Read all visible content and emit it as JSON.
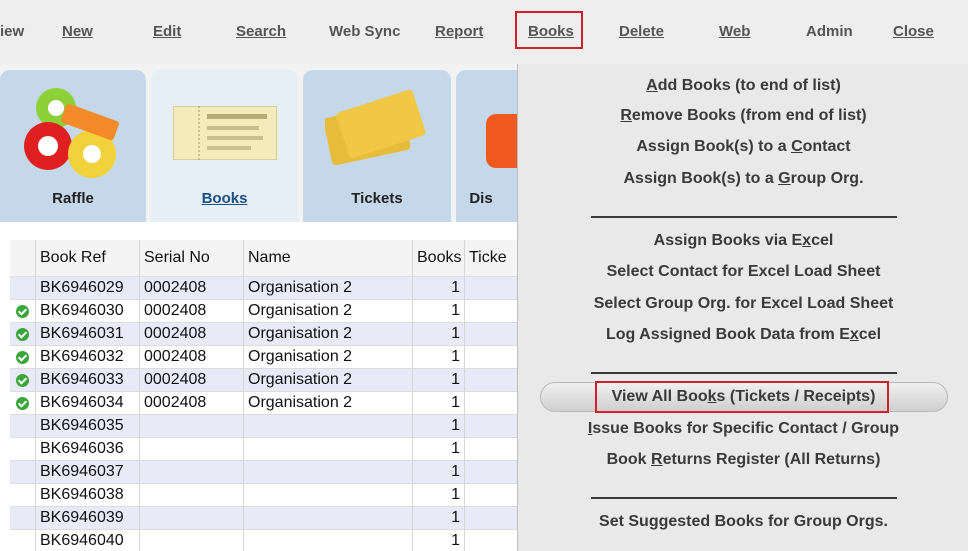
{
  "menubar": {
    "items": [
      {
        "label": "iew",
        "underline": false
      },
      {
        "label": "New",
        "underline": true
      },
      {
        "label": "Edit",
        "underline": true
      },
      {
        "label": "Search",
        "underline": true
      },
      {
        "label": "Web Sync",
        "underline": false
      },
      {
        "label": "Report",
        "underline": true
      },
      {
        "label": "Books",
        "underline": true
      },
      {
        "label": "Delete",
        "underline": true
      },
      {
        "label": "Web",
        "underline": true
      },
      {
        "label": "Admin",
        "underline": false
      },
      {
        "label": "Close",
        "underline": true
      }
    ]
  },
  "tabs": [
    {
      "label": "Raffle",
      "icon": "raffle-balls-icon"
    },
    {
      "label": "Books",
      "icon": "raffle-book-icon"
    },
    {
      "label": "Tickets",
      "icon": "ticket-icon"
    },
    {
      "label": "Dis",
      "icon": "discount-tag-icon"
    }
  ],
  "grid": {
    "columns": [
      "",
      "Book Ref",
      "Serial No",
      "Name",
      "Books",
      "Ticke"
    ],
    "rows": [
      {
        "check": false,
        "ref": "BK6946029",
        "serial": "0002408",
        "name": "Organisation 2",
        "books": "1"
      },
      {
        "check": true,
        "ref": "BK6946030",
        "serial": "0002408",
        "name": "Organisation 2",
        "books": "1"
      },
      {
        "check": true,
        "ref": "BK6946031",
        "serial": "0002408",
        "name": "Organisation 2",
        "books": "1"
      },
      {
        "check": true,
        "ref": "BK6946032",
        "serial": "0002408",
        "name": "Organisation 2",
        "books": "1"
      },
      {
        "check": true,
        "ref": "BK6946033",
        "serial": "0002408",
        "name": "Organisation 2",
        "books": "1"
      },
      {
        "check": true,
        "ref": "BK6946034",
        "serial": "0002408",
        "name": "Organisation 2",
        "books": "1"
      },
      {
        "check": false,
        "ref": "BK6946035",
        "serial": "",
        "name": "",
        "books": "1"
      },
      {
        "check": false,
        "ref": "BK6946036",
        "serial": "",
        "name": "",
        "books": "1"
      },
      {
        "check": false,
        "ref": "BK6946037",
        "serial": "",
        "name": "",
        "books": "1"
      },
      {
        "check": false,
        "ref": "BK6946038",
        "serial": "",
        "name": "",
        "books": "1"
      },
      {
        "check": false,
        "ref": "BK6946039",
        "serial": "",
        "name": "",
        "books": "1"
      },
      {
        "check": false,
        "ref": "BK6946040",
        "serial": "",
        "name": "",
        "books": "1"
      }
    ]
  },
  "dropdown": {
    "items": [
      {
        "pre": "",
        "u": "A",
        "post": "dd Books (to end of list)"
      },
      {
        "pre": "",
        "u": "R",
        "post": "emove Books (from end of list)"
      },
      {
        "pre": "Assign Book(s) to a ",
        "u": "C",
        "post": "ontact"
      },
      {
        "pre": "Assign Book(s) to a ",
        "u": "G",
        "post": "roup Org."
      },
      {
        "pre": "Assign Books via E",
        "u": "x",
        "post": "cel"
      },
      {
        "pre": "Select Contact for Excel Load Sheet",
        "u": "",
        "post": ""
      },
      {
        "pre": "Select Group Org. for Excel Load Sheet",
        "u": "",
        "post": ""
      },
      {
        "pre": "Log Assigned Book Data from E",
        "u": "x",
        "post": "cel"
      },
      {
        "pre": "View All Boo",
        "u": "k",
        "post": "s (Tickets / Receipts)"
      },
      {
        "pre": "",
        "u": "I",
        "post": "ssue Books for Specific Contact / Group"
      },
      {
        "pre": "Book ",
        "u": "R",
        "post": "eturns Register (All Returns)"
      },
      {
        "pre": "Set Suggested Books for Group Orgs.",
        "u": "",
        "post": ""
      }
    ]
  },
  "colors": {
    "highlight": "#d0202a",
    "tab": "#c4d8ea",
    "tab_active": "#e6eef6"
  }
}
